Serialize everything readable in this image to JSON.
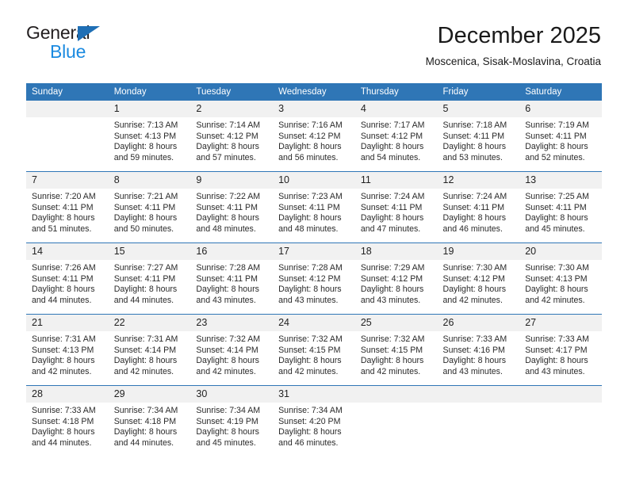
{
  "brand": {
    "name_part1": "General",
    "name_part2": "Blue",
    "triangle_color": "#1f6fb5",
    "blue_color": "#1b8ae0"
  },
  "header": {
    "title": "December 2025",
    "subtitle": "Moscenica, Sisak-Moslavina, Croatia",
    "accent_color": "#2f76b6"
  },
  "weekday_headers": [
    "Sunday",
    "Monday",
    "Tuesday",
    "Wednesday",
    "Thursday",
    "Friday",
    "Saturday"
  ],
  "weeks": [
    [
      {
        "day": "",
        "sunrise": "",
        "sunset": "",
        "daylight_line1": "",
        "daylight_line2": ""
      },
      {
        "day": "1",
        "sunrise": "Sunrise: 7:13 AM",
        "sunset": "Sunset: 4:13 PM",
        "daylight_line1": "Daylight: 8 hours",
        "daylight_line2": "and 59 minutes."
      },
      {
        "day": "2",
        "sunrise": "Sunrise: 7:14 AM",
        "sunset": "Sunset: 4:12 PM",
        "daylight_line1": "Daylight: 8 hours",
        "daylight_line2": "and 57 minutes."
      },
      {
        "day": "3",
        "sunrise": "Sunrise: 7:16 AM",
        "sunset": "Sunset: 4:12 PM",
        "daylight_line1": "Daylight: 8 hours",
        "daylight_line2": "and 56 minutes."
      },
      {
        "day": "4",
        "sunrise": "Sunrise: 7:17 AM",
        "sunset": "Sunset: 4:12 PM",
        "daylight_line1": "Daylight: 8 hours",
        "daylight_line2": "and 54 minutes."
      },
      {
        "day": "5",
        "sunrise": "Sunrise: 7:18 AM",
        "sunset": "Sunset: 4:11 PM",
        "daylight_line1": "Daylight: 8 hours",
        "daylight_line2": "and 53 minutes."
      },
      {
        "day": "6",
        "sunrise": "Sunrise: 7:19 AM",
        "sunset": "Sunset: 4:11 PM",
        "daylight_line1": "Daylight: 8 hours",
        "daylight_line2": "and 52 minutes."
      }
    ],
    [
      {
        "day": "7",
        "sunrise": "Sunrise: 7:20 AM",
        "sunset": "Sunset: 4:11 PM",
        "daylight_line1": "Daylight: 8 hours",
        "daylight_line2": "and 51 minutes."
      },
      {
        "day": "8",
        "sunrise": "Sunrise: 7:21 AM",
        "sunset": "Sunset: 4:11 PM",
        "daylight_line1": "Daylight: 8 hours",
        "daylight_line2": "and 50 minutes."
      },
      {
        "day": "9",
        "sunrise": "Sunrise: 7:22 AM",
        "sunset": "Sunset: 4:11 PM",
        "daylight_line1": "Daylight: 8 hours",
        "daylight_line2": "and 48 minutes."
      },
      {
        "day": "10",
        "sunrise": "Sunrise: 7:23 AM",
        "sunset": "Sunset: 4:11 PM",
        "daylight_line1": "Daylight: 8 hours",
        "daylight_line2": "and 48 minutes."
      },
      {
        "day": "11",
        "sunrise": "Sunrise: 7:24 AM",
        "sunset": "Sunset: 4:11 PM",
        "daylight_line1": "Daylight: 8 hours",
        "daylight_line2": "and 47 minutes."
      },
      {
        "day": "12",
        "sunrise": "Sunrise: 7:24 AM",
        "sunset": "Sunset: 4:11 PM",
        "daylight_line1": "Daylight: 8 hours",
        "daylight_line2": "and 46 minutes."
      },
      {
        "day": "13",
        "sunrise": "Sunrise: 7:25 AM",
        "sunset": "Sunset: 4:11 PM",
        "daylight_line1": "Daylight: 8 hours",
        "daylight_line2": "and 45 minutes."
      }
    ],
    [
      {
        "day": "14",
        "sunrise": "Sunrise: 7:26 AM",
        "sunset": "Sunset: 4:11 PM",
        "daylight_line1": "Daylight: 8 hours",
        "daylight_line2": "and 44 minutes."
      },
      {
        "day": "15",
        "sunrise": "Sunrise: 7:27 AM",
        "sunset": "Sunset: 4:11 PM",
        "daylight_line1": "Daylight: 8 hours",
        "daylight_line2": "and 44 minutes."
      },
      {
        "day": "16",
        "sunrise": "Sunrise: 7:28 AM",
        "sunset": "Sunset: 4:11 PM",
        "daylight_line1": "Daylight: 8 hours",
        "daylight_line2": "and 43 minutes."
      },
      {
        "day": "17",
        "sunrise": "Sunrise: 7:28 AM",
        "sunset": "Sunset: 4:12 PM",
        "daylight_line1": "Daylight: 8 hours",
        "daylight_line2": "and 43 minutes."
      },
      {
        "day": "18",
        "sunrise": "Sunrise: 7:29 AM",
        "sunset": "Sunset: 4:12 PM",
        "daylight_line1": "Daylight: 8 hours",
        "daylight_line2": "and 43 minutes."
      },
      {
        "day": "19",
        "sunrise": "Sunrise: 7:30 AM",
        "sunset": "Sunset: 4:12 PM",
        "daylight_line1": "Daylight: 8 hours",
        "daylight_line2": "and 42 minutes."
      },
      {
        "day": "20",
        "sunrise": "Sunrise: 7:30 AM",
        "sunset": "Sunset: 4:13 PM",
        "daylight_line1": "Daylight: 8 hours",
        "daylight_line2": "and 42 minutes."
      }
    ],
    [
      {
        "day": "21",
        "sunrise": "Sunrise: 7:31 AM",
        "sunset": "Sunset: 4:13 PM",
        "daylight_line1": "Daylight: 8 hours",
        "daylight_line2": "and 42 minutes."
      },
      {
        "day": "22",
        "sunrise": "Sunrise: 7:31 AM",
        "sunset": "Sunset: 4:14 PM",
        "daylight_line1": "Daylight: 8 hours",
        "daylight_line2": "and 42 minutes."
      },
      {
        "day": "23",
        "sunrise": "Sunrise: 7:32 AM",
        "sunset": "Sunset: 4:14 PM",
        "daylight_line1": "Daylight: 8 hours",
        "daylight_line2": "and 42 minutes."
      },
      {
        "day": "24",
        "sunrise": "Sunrise: 7:32 AM",
        "sunset": "Sunset: 4:15 PM",
        "daylight_line1": "Daylight: 8 hours",
        "daylight_line2": "and 42 minutes."
      },
      {
        "day": "25",
        "sunrise": "Sunrise: 7:32 AM",
        "sunset": "Sunset: 4:15 PM",
        "daylight_line1": "Daylight: 8 hours",
        "daylight_line2": "and 42 minutes."
      },
      {
        "day": "26",
        "sunrise": "Sunrise: 7:33 AM",
        "sunset": "Sunset: 4:16 PM",
        "daylight_line1": "Daylight: 8 hours",
        "daylight_line2": "and 43 minutes."
      },
      {
        "day": "27",
        "sunrise": "Sunrise: 7:33 AM",
        "sunset": "Sunset: 4:17 PM",
        "daylight_line1": "Daylight: 8 hours",
        "daylight_line2": "and 43 minutes."
      }
    ],
    [
      {
        "day": "28",
        "sunrise": "Sunrise: 7:33 AM",
        "sunset": "Sunset: 4:18 PM",
        "daylight_line1": "Daylight: 8 hours",
        "daylight_line2": "and 44 minutes."
      },
      {
        "day": "29",
        "sunrise": "Sunrise: 7:34 AM",
        "sunset": "Sunset: 4:18 PM",
        "daylight_line1": "Daylight: 8 hours",
        "daylight_line2": "and 44 minutes."
      },
      {
        "day": "30",
        "sunrise": "Sunrise: 7:34 AM",
        "sunset": "Sunset: 4:19 PM",
        "daylight_line1": "Daylight: 8 hours",
        "daylight_line2": "and 45 minutes."
      },
      {
        "day": "31",
        "sunrise": "Sunrise: 7:34 AM",
        "sunset": "Sunset: 4:20 PM",
        "daylight_line1": "Daylight: 8 hours",
        "daylight_line2": "and 46 minutes."
      },
      {
        "day": "",
        "sunrise": "",
        "sunset": "",
        "daylight_line1": "",
        "daylight_line2": ""
      },
      {
        "day": "",
        "sunrise": "",
        "sunset": "",
        "daylight_line1": "",
        "daylight_line2": ""
      },
      {
        "day": "",
        "sunrise": "",
        "sunset": "",
        "daylight_line1": "",
        "daylight_line2": ""
      }
    ]
  ]
}
